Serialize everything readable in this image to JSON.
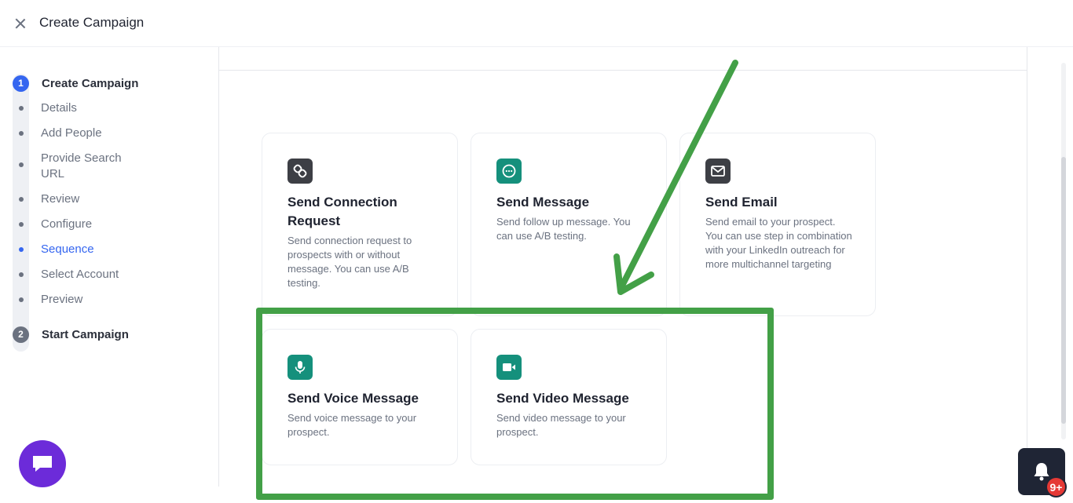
{
  "header": {
    "title": "Create Campaign"
  },
  "stepper": {
    "steps": [
      {
        "number": "1",
        "label": "Create Campaign"
      },
      {
        "number": "2",
        "label": "Start Campaign"
      }
    ],
    "substeps": [
      {
        "label": "Details"
      },
      {
        "label": "Add People"
      },
      {
        "label": "Provide Search URL"
      },
      {
        "label": "Review"
      },
      {
        "label": "Configure"
      },
      {
        "label": "Sequence",
        "active": true
      },
      {
        "label": "Select Account"
      },
      {
        "label": "Preview"
      }
    ]
  },
  "cards": [
    {
      "title": "Send Connection Request",
      "description": "Send connection request to prospects with or without message. You can use A/B testing.",
      "icon": "link-icon"
    },
    {
      "title": "Send Message",
      "description": "Send follow up message. You can use A/B testing.",
      "icon": "chat-bubble-icon"
    },
    {
      "title": "Send Email",
      "description": "Send email to your prospect. You can use step in combination with your LinkedIn outreach for more multichannel targeting",
      "icon": "envelope-icon"
    },
    {
      "title": "Send Voice Message",
      "description": "Send voice message to your prospect.",
      "icon": "microphone-icon"
    },
    {
      "title": "Send Video Message",
      "description": "Send video message to your prospect.",
      "icon": "video-camera-icon"
    }
  ],
  "notifications": {
    "badge": "9+"
  },
  "colors": {
    "accent": "#3566f0",
    "teal": "#15907c",
    "annotation": "#43a047",
    "chat": "#6c2bd9",
    "badge": "#e53935"
  }
}
